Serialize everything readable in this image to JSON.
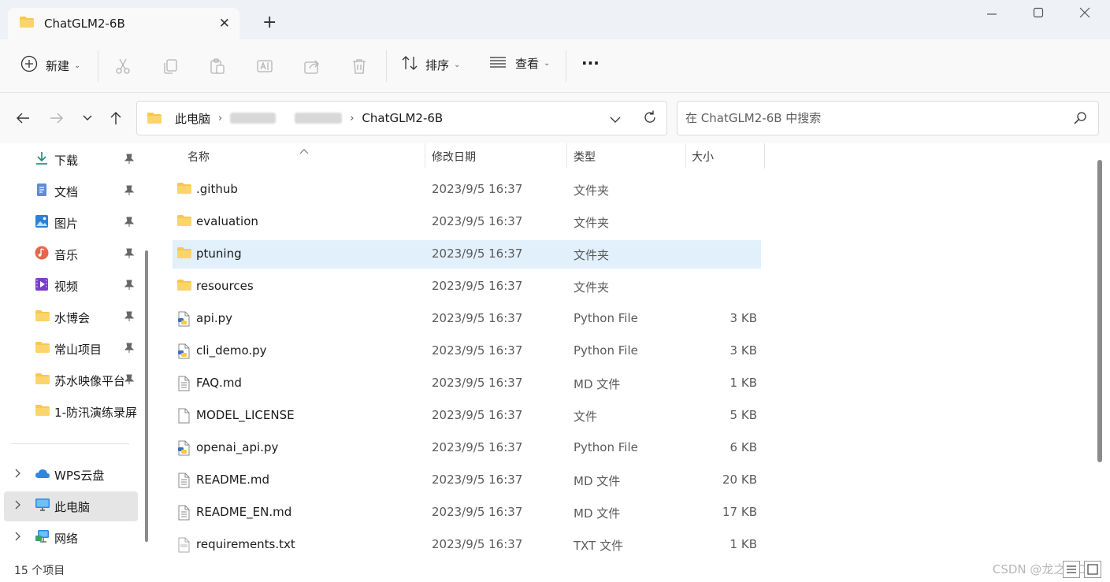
{
  "tab": {
    "title": "ChatGLM2-6B",
    "close": "✕",
    "new": "+"
  },
  "window": {
    "minimize": "—",
    "maximize": "☐",
    "close": "✕"
  },
  "toolbar": {
    "new_label": "新建",
    "sort_label": "排序",
    "view_label": "查看",
    "more": "···",
    "chevron": "⌄"
  },
  "address": {
    "crumb_root": "此电脑",
    "crumb_current": "ChatGLM2-6B",
    "separator": "›",
    "search_placeholder": "在 ChatGLM2-6B 中搜索"
  },
  "sidebar": {
    "quick": [
      {
        "label": "下载",
        "icon": "download-icon"
      },
      {
        "label": "文档",
        "icon": "document-icon"
      },
      {
        "label": "图片",
        "icon": "picture-icon"
      },
      {
        "label": "音乐",
        "icon": "music-icon"
      },
      {
        "label": "视频",
        "icon": "video-icon"
      },
      {
        "label": "水博会",
        "icon": "folder-icon"
      },
      {
        "label": "常山项目",
        "icon": "folder-icon"
      },
      {
        "label": "苏水映像平台",
        "icon": "folder-icon"
      },
      {
        "label": "1-防汛演练录屏",
        "icon": "folder-icon"
      }
    ],
    "roots": [
      {
        "label": "WPS云盘",
        "icon": "cloud-icon"
      },
      {
        "label": "此电脑",
        "icon": "computer-icon"
      },
      {
        "label": "网络",
        "icon": "network-icon"
      }
    ]
  },
  "columns": {
    "name": "名称",
    "modified": "修改日期",
    "type": "类型",
    "size": "大小"
  },
  "files": [
    {
      "name": ".github",
      "modified": "2023/9/5 16:37",
      "type": "文件夹",
      "size": "",
      "icon": "folder-icon"
    },
    {
      "name": "evaluation",
      "modified": "2023/9/5 16:37",
      "type": "文件夹",
      "size": "",
      "icon": "folder-icon"
    },
    {
      "name": "ptuning",
      "modified": "2023/9/5 16:37",
      "type": "文件夹",
      "size": "",
      "icon": "folder-icon"
    },
    {
      "name": "resources",
      "modified": "2023/9/5 16:37",
      "type": "文件夹",
      "size": "",
      "icon": "folder-icon"
    },
    {
      "name": "api.py",
      "modified": "2023/9/5 16:37",
      "type": "Python File",
      "size": "3 KB",
      "icon": "python-file-icon"
    },
    {
      "name": "cli_demo.py",
      "modified": "2023/9/5 16:37",
      "type": "Python File",
      "size": "3 KB",
      "icon": "python-file-icon"
    },
    {
      "name": "FAQ.md",
      "modified": "2023/9/5 16:37",
      "type": "MD 文件",
      "size": "1 KB",
      "icon": "text-file-icon"
    },
    {
      "name": "MODEL_LICENSE",
      "modified": "2023/9/5 16:37",
      "type": "文件",
      "size": "5 KB",
      "icon": "blank-file-icon"
    },
    {
      "name": "openai_api.py",
      "modified": "2023/9/5 16:37",
      "type": "Python File",
      "size": "6 KB",
      "icon": "python-file-icon"
    },
    {
      "name": "README.md",
      "modified": "2023/9/5 16:37",
      "type": "MD 文件",
      "size": "20 KB",
      "icon": "text-file-icon"
    },
    {
      "name": "README_EN.md",
      "modified": "2023/9/5 16:37",
      "type": "MD 文件",
      "size": "17 KB",
      "icon": "text-file-icon"
    },
    {
      "name": "requirements.txt",
      "modified": "2023/9/5 16:37",
      "type": "TXT 文件",
      "size": "1 KB",
      "icon": "txt-file-icon"
    }
  ],
  "status": {
    "count": "15 个项目",
    "watermark": "CSDN @龙之吻OO"
  },
  "colors": {
    "selected_row": "#e1f0fb",
    "folder": "#f8c74e",
    "accent": "#0067c0"
  }
}
